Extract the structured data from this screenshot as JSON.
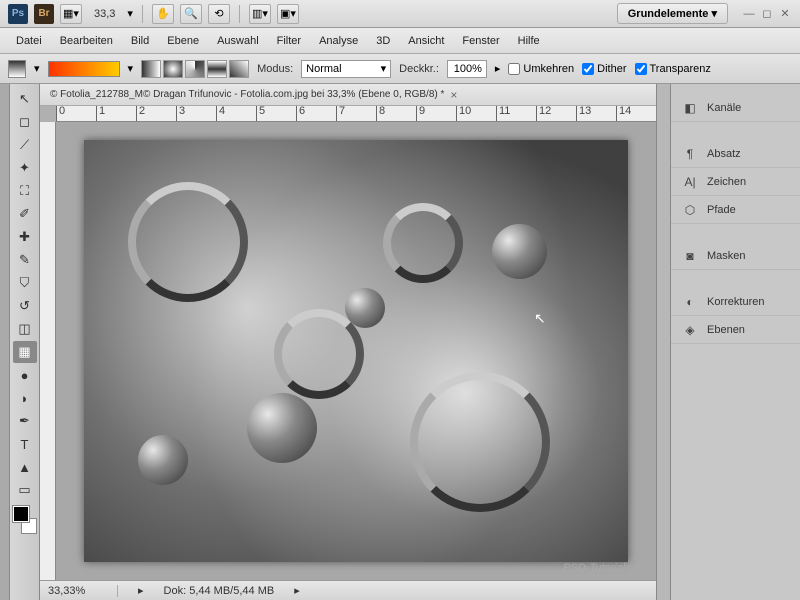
{
  "top": {
    "zoom": "33,3",
    "workspace": "Grundelemente"
  },
  "menu": [
    "Datei",
    "Bearbeiten",
    "Bild",
    "Ebene",
    "Auswahl",
    "Filter",
    "Analyse",
    "3D",
    "Ansicht",
    "Fenster",
    "Hilfe"
  ],
  "options": {
    "mode_label": "Modus:",
    "mode_value": "Normal",
    "opacity_label": "Deckkr.:",
    "opacity_value": "100%",
    "reverse": "Umkehren",
    "dither": "Dither",
    "transparency": "Transparenz"
  },
  "document": {
    "tab": "© Fotolia_212788_M© Dragan Trifunovic - Fotolia.com.jpg bei 33,3% (Ebene 0, RGB/8) *"
  },
  "ruler_ticks": [
    "0",
    "1",
    "2",
    "3",
    "4",
    "5",
    "6",
    "7",
    "8",
    "9",
    "10",
    "11",
    "12",
    "13",
    "14"
  ],
  "panels": [
    {
      "icon": "◧",
      "label": "Kanäle"
    },
    {
      "icon": "¶",
      "label": "Absatz"
    },
    {
      "icon": "A|",
      "label": "Zeichen"
    },
    {
      "icon": "⬡",
      "label": "Pfade"
    },
    {
      "icon": "◙",
      "label": "Masken"
    },
    {
      "icon": "◐",
      "label": "Korrekturen"
    },
    {
      "icon": "◈",
      "label": "Ebenen"
    }
  ],
  "status": {
    "zoom": "33,33%",
    "doc": "Dok: 5,44 MB/5,44 MB"
  },
  "watermark": "PSD-Tutorials.de"
}
